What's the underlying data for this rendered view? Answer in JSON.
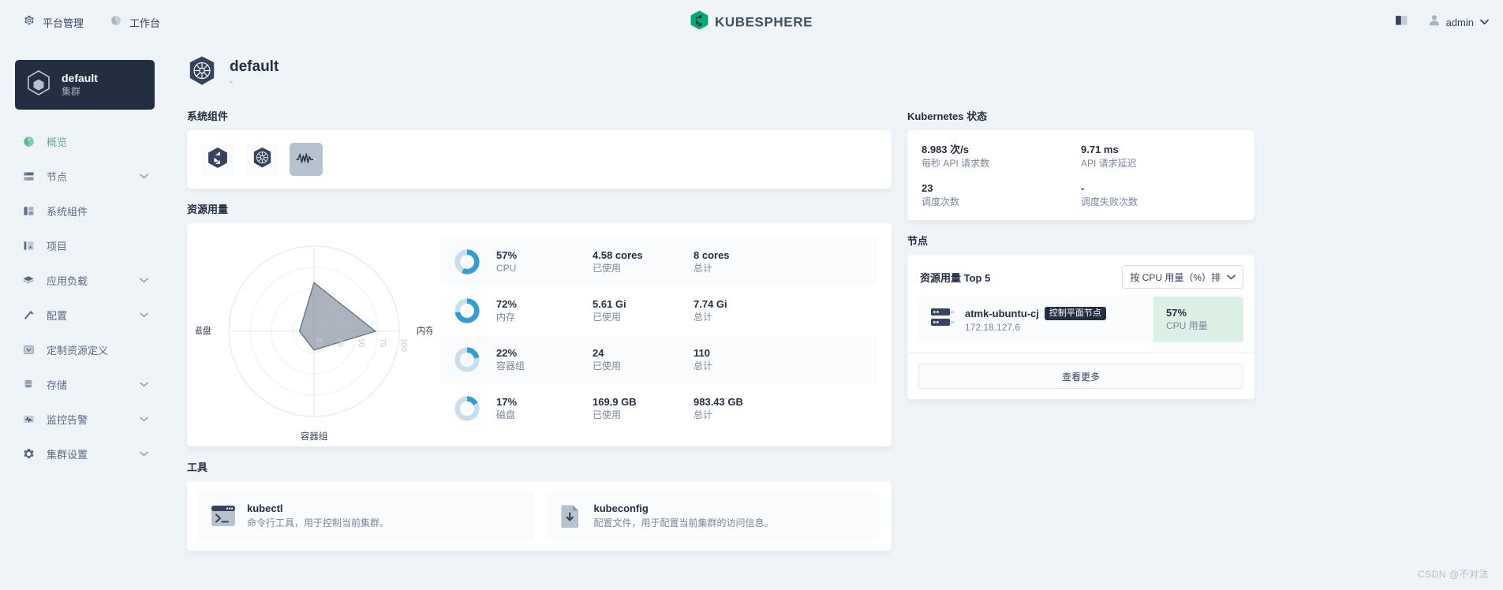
{
  "topbar": {
    "nav": [
      {
        "label": "平台管理",
        "icon": "gear-icon"
      },
      {
        "label": "工作台",
        "icon": "workbench-icon"
      }
    ],
    "brand": "KUBESPHERE",
    "docs_icon": "book-icon",
    "user": {
      "name": "admin",
      "avatar_icon": "user-icon",
      "caret_icon": "chevron-down-icon"
    }
  },
  "sidebar": {
    "cluster": {
      "name": "default",
      "type": "集群",
      "icon": "cube-icon"
    },
    "items": [
      {
        "label": "概览",
        "icon": "overview-icon",
        "active": true,
        "expandable": false
      },
      {
        "label": "节点",
        "icon": "node-icon",
        "active": false,
        "expandable": true
      },
      {
        "label": "系统组件",
        "icon": "components-icon",
        "active": false,
        "expandable": false
      },
      {
        "label": "项目",
        "icon": "project-icon",
        "active": false,
        "expandable": false
      },
      {
        "label": "应用负载",
        "icon": "workload-icon",
        "active": false,
        "expandable": true
      },
      {
        "label": "配置",
        "icon": "config-icon",
        "active": false,
        "expandable": true
      },
      {
        "label": "定制资源定义",
        "icon": "crd-icon",
        "active": false,
        "expandable": false
      },
      {
        "label": "存储",
        "icon": "storage-icon",
        "active": false,
        "expandable": true
      },
      {
        "label": "监控告警",
        "icon": "monitoring-icon",
        "active": false,
        "expandable": true
      },
      {
        "label": "集群设置",
        "icon": "settings-icon",
        "active": false,
        "expandable": true
      }
    ]
  },
  "page": {
    "title": "default",
    "subtitle": "-",
    "icon": "kubernetes-icon"
  },
  "sections": {
    "system_components": "系统组件",
    "resource_usage": "资源用量",
    "tools": "工具",
    "kubernetes_status": "Kubernetes 状态",
    "nodes": "节点"
  },
  "system_components": [
    {
      "name": "kubesphere-component",
      "icon": "kubesphere-logo-icon",
      "style": "light"
    },
    {
      "name": "kubernetes-component",
      "icon": "kubernetes-icon",
      "style": "light"
    },
    {
      "name": "monitoring-component",
      "icon": "pulse-chart-icon",
      "style": "gray"
    }
  ],
  "chart_data": {
    "type": "radar",
    "title": "资源用量",
    "categories": [
      "CPU",
      "内存",
      "容器组",
      "磁盘"
    ],
    "values": [
      57,
      72,
      22,
      17
    ],
    "ticks": [
      0,
      25,
      50,
      75,
      100
    ],
    "rlim": [
      0,
      100
    ],
    "unit": "%",
    "grid": true,
    "legend": false,
    "fill_color": "#8a95a6",
    "stroke_color": "#69758a"
  },
  "metrics": [
    {
      "percent": "57%",
      "label": "CPU",
      "used": "4.58 cores",
      "used_label": "已使用",
      "total": "8 cores",
      "total_label": "总计",
      "ratio": 57
    },
    {
      "percent": "72%",
      "label": "内存",
      "used": "5.61 Gi",
      "used_label": "已使用",
      "total": "7.74 Gi",
      "total_label": "总计",
      "ratio": 72
    },
    {
      "percent": "22%",
      "label": "容器组",
      "used": "24",
      "used_label": "已使用",
      "total": "110",
      "total_label": "总计",
      "ratio": 22
    },
    {
      "percent": "17%",
      "label": "磁盘",
      "used": "169.9 GB",
      "used_label": "已使用",
      "total": "983.43 GB",
      "total_label": "总计",
      "ratio": 17
    }
  ],
  "tools": [
    {
      "name": "kubectl",
      "desc": "命令行工具，用于控制当前集群。",
      "icon": "terminal-icon"
    },
    {
      "name": "kubeconfig",
      "desc": "配置文件，用于配置当前集群的访问信息。",
      "icon": "file-download-icon"
    }
  ],
  "kubernetes_status": [
    {
      "value": "8.983 次/s",
      "label": "每秒 API 请求数"
    },
    {
      "value": "9.71 ms",
      "label": "API 请求延迟"
    },
    {
      "value": "23",
      "label": "调度次数"
    },
    {
      "value": "-",
      "label": "调度失败次数"
    }
  ],
  "nodes": {
    "list_title": "资源用量 Top 5",
    "sort": {
      "label": "按 CPU 用量（%）排",
      "icon": "chevron-down-icon"
    },
    "rows": [
      {
        "name": "atmk-ubuntu-cj",
        "badge": "控制平面节点",
        "ip": "172.18.127.6",
        "value": "57%",
        "value_label": "CPU 用量",
        "icon": "server-icon"
      }
    ],
    "more_label": "查看更多"
  },
  "watermark": "CSDN @不对法",
  "colors": {
    "brand_green": "#55bc8a",
    "dark_navy": "#242e42",
    "page_bg": "#eff4f9",
    "donut_blue": "#329dce",
    "donut_track": "#c7deed",
    "highlight_green": "#dcf1e5"
  }
}
